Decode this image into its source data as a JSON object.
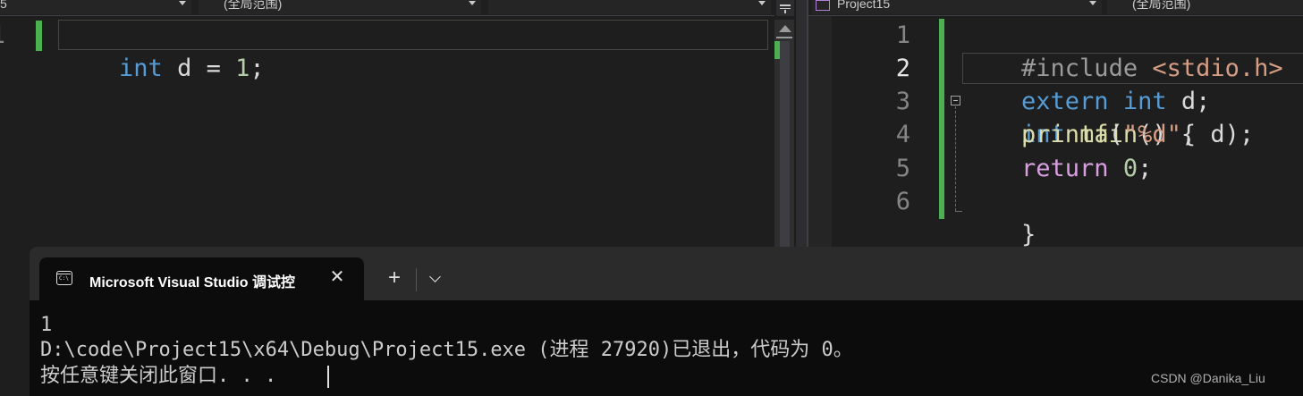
{
  "left_editor": {
    "nav_project": "5",
    "nav_scope": "(全局范围)",
    "line_numbers": [
      "1"
    ],
    "line1": {
      "kw": "int",
      "rest": " d = ",
      "num": "1",
      "end": ";"
    }
  },
  "right_editor": {
    "nav_project": "Project15",
    "nav_scope": "(全局范围)",
    "line_numbers": [
      "1",
      "2",
      "3",
      "4",
      "5",
      "6"
    ],
    "lines": {
      "l1_pp": "#include ",
      "l1_str": "<stdio.h>",
      "l2_kw1": "extern",
      "l2_kw2": "int",
      "l2_rest": " d;",
      "l3_kw": "int",
      "l3_fn": "main",
      "l3_rest": "() {",
      "l4_fn": "printf",
      "l4_p1": "(",
      "l4_str": "\"%d\"",
      "l4_rest": ", d);",
      "l5_kw": "return",
      "l5_num": "0",
      "l5_end": ";",
      "l6": "}"
    }
  },
  "console": {
    "tab_title": "Microsoft Visual Studio 调试控",
    "tab_icon": "console-icon",
    "output_lines": [
      "1",
      "D:\\code\\Project15\\x64\\Debug\\Project15.exe (进程 27920)已退出，代码为 0。",
      "按任意键关闭此窗口. . ."
    ]
  },
  "watermark": "CSDN @Danika_Liu",
  "colors": {
    "keyword": "#569cd6",
    "string": "#d69d85",
    "function": "#dcdcaa",
    "number": "#b5cea8",
    "control": "#d8a0df",
    "change_bar": "#4caf50"
  }
}
